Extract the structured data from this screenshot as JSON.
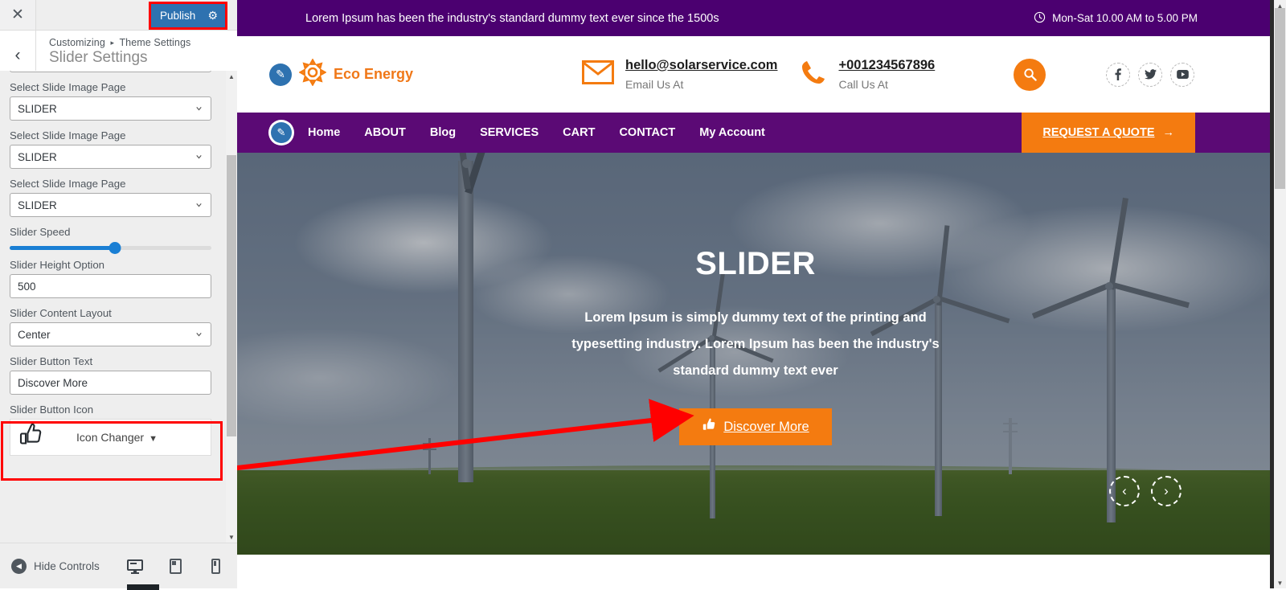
{
  "customizer": {
    "close_icon": "close-icon",
    "publish_label": "Publish",
    "gear_icon": "gear-icon",
    "back_icon": "chevron-left-icon",
    "breadcrumb_root": "Customizing",
    "breadcrumb_sep": "▸",
    "breadcrumb_current": "Theme Settings",
    "panel_title": "Slider Settings",
    "controls": [
      {
        "label": "",
        "type": "select",
        "value": "SLIDER",
        "name": "select-slide-image-page-0"
      },
      {
        "label": "Select Slide Image Page",
        "type": "select",
        "value": "SLIDER",
        "name": "select-slide-image-page-1"
      },
      {
        "label": "Select Slide Image Page",
        "type": "select",
        "value": "SLIDER",
        "name": "select-slide-image-page-2"
      },
      {
        "label": "Select Slide Image Page",
        "type": "select",
        "value": "SLIDER",
        "name": "select-slide-image-page-3"
      },
      {
        "label": "Slider Speed",
        "type": "range",
        "value": 52,
        "name": "slider-speed"
      },
      {
        "label": "Slider Height Option",
        "type": "text",
        "value": "500",
        "name": "slider-height-option"
      },
      {
        "label": "Slider Content Layout",
        "type": "select",
        "value": "Center",
        "name": "slider-content-layout"
      },
      {
        "label": "Slider Button Text",
        "type": "text",
        "value": "Discover More",
        "name": "slider-button-text"
      },
      {
        "label": "Slider Button Icon",
        "type": "iconpicker",
        "value": "Icon Changer",
        "name": "slider-button-icon"
      }
    ],
    "icon_picker_glyph": "hand-pointer-icon",
    "footer": {
      "hide_controls_label": "Hide Controls",
      "collapse_icon": "chevron-left-circle-icon",
      "devices": [
        {
          "name": "desktop-preview-icon",
          "active": true
        },
        {
          "name": "tablet-preview-icon",
          "active": false
        },
        {
          "name": "mobile-preview-icon",
          "active": false
        }
      ]
    },
    "accent_publish": "#2e72b0",
    "highlight_color": "#ff0000"
  },
  "site": {
    "topbar": {
      "message": "Lorem Ipsum has been the industry's standard dummy text ever since the 1500s",
      "clock_icon": "clock-icon",
      "hours": "Mon-Sat 10.00 AM to 5.00 PM",
      "bg": "#4b0070"
    },
    "header": {
      "edit_icon": "edit-pencil-icon",
      "logo_icon": "sun-icon",
      "brand": "Eco Energy",
      "email": {
        "icon": "envelope-icon",
        "value": "hello@solarservice.com",
        "caption": "Email Us At"
      },
      "phone": {
        "icon": "phone-icon",
        "value": "+001234567896",
        "caption": "Call Us At"
      },
      "search_icon": "search-icon",
      "socials": [
        {
          "name": "facebook-icon",
          "glyph": "f"
        },
        {
          "name": "twitter-icon",
          "glyph": "t"
        },
        {
          "name": "youtube-icon",
          "glyph": "y"
        }
      ]
    },
    "nav": {
      "edit_icon": "edit-pencil-icon",
      "items": [
        "Home",
        "ABOUT",
        "Blog",
        "SERVICES",
        "CART",
        "CONTACT",
        "My Account"
      ],
      "cta_label": "REQUEST A QUOTE",
      "cta_icon": "arrow-right-icon",
      "bg": "#5b0a75",
      "cta_bg": "#f47b10"
    },
    "hero": {
      "title": "SLIDER",
      "description": "Lorem Ipsum is simply dummy text of the printing and typesetting industry. Lorem Ipsum has been the industry's standard dummy text ever",
      "button_label": "Discover More",
      "button_icon": "hand-pointer-icon",
      "prev_icon": "chevron-left-icon",
      "next_icon": "chevron-right-icon",
      "button_bg": "#f47b10"
    }
  }
}
